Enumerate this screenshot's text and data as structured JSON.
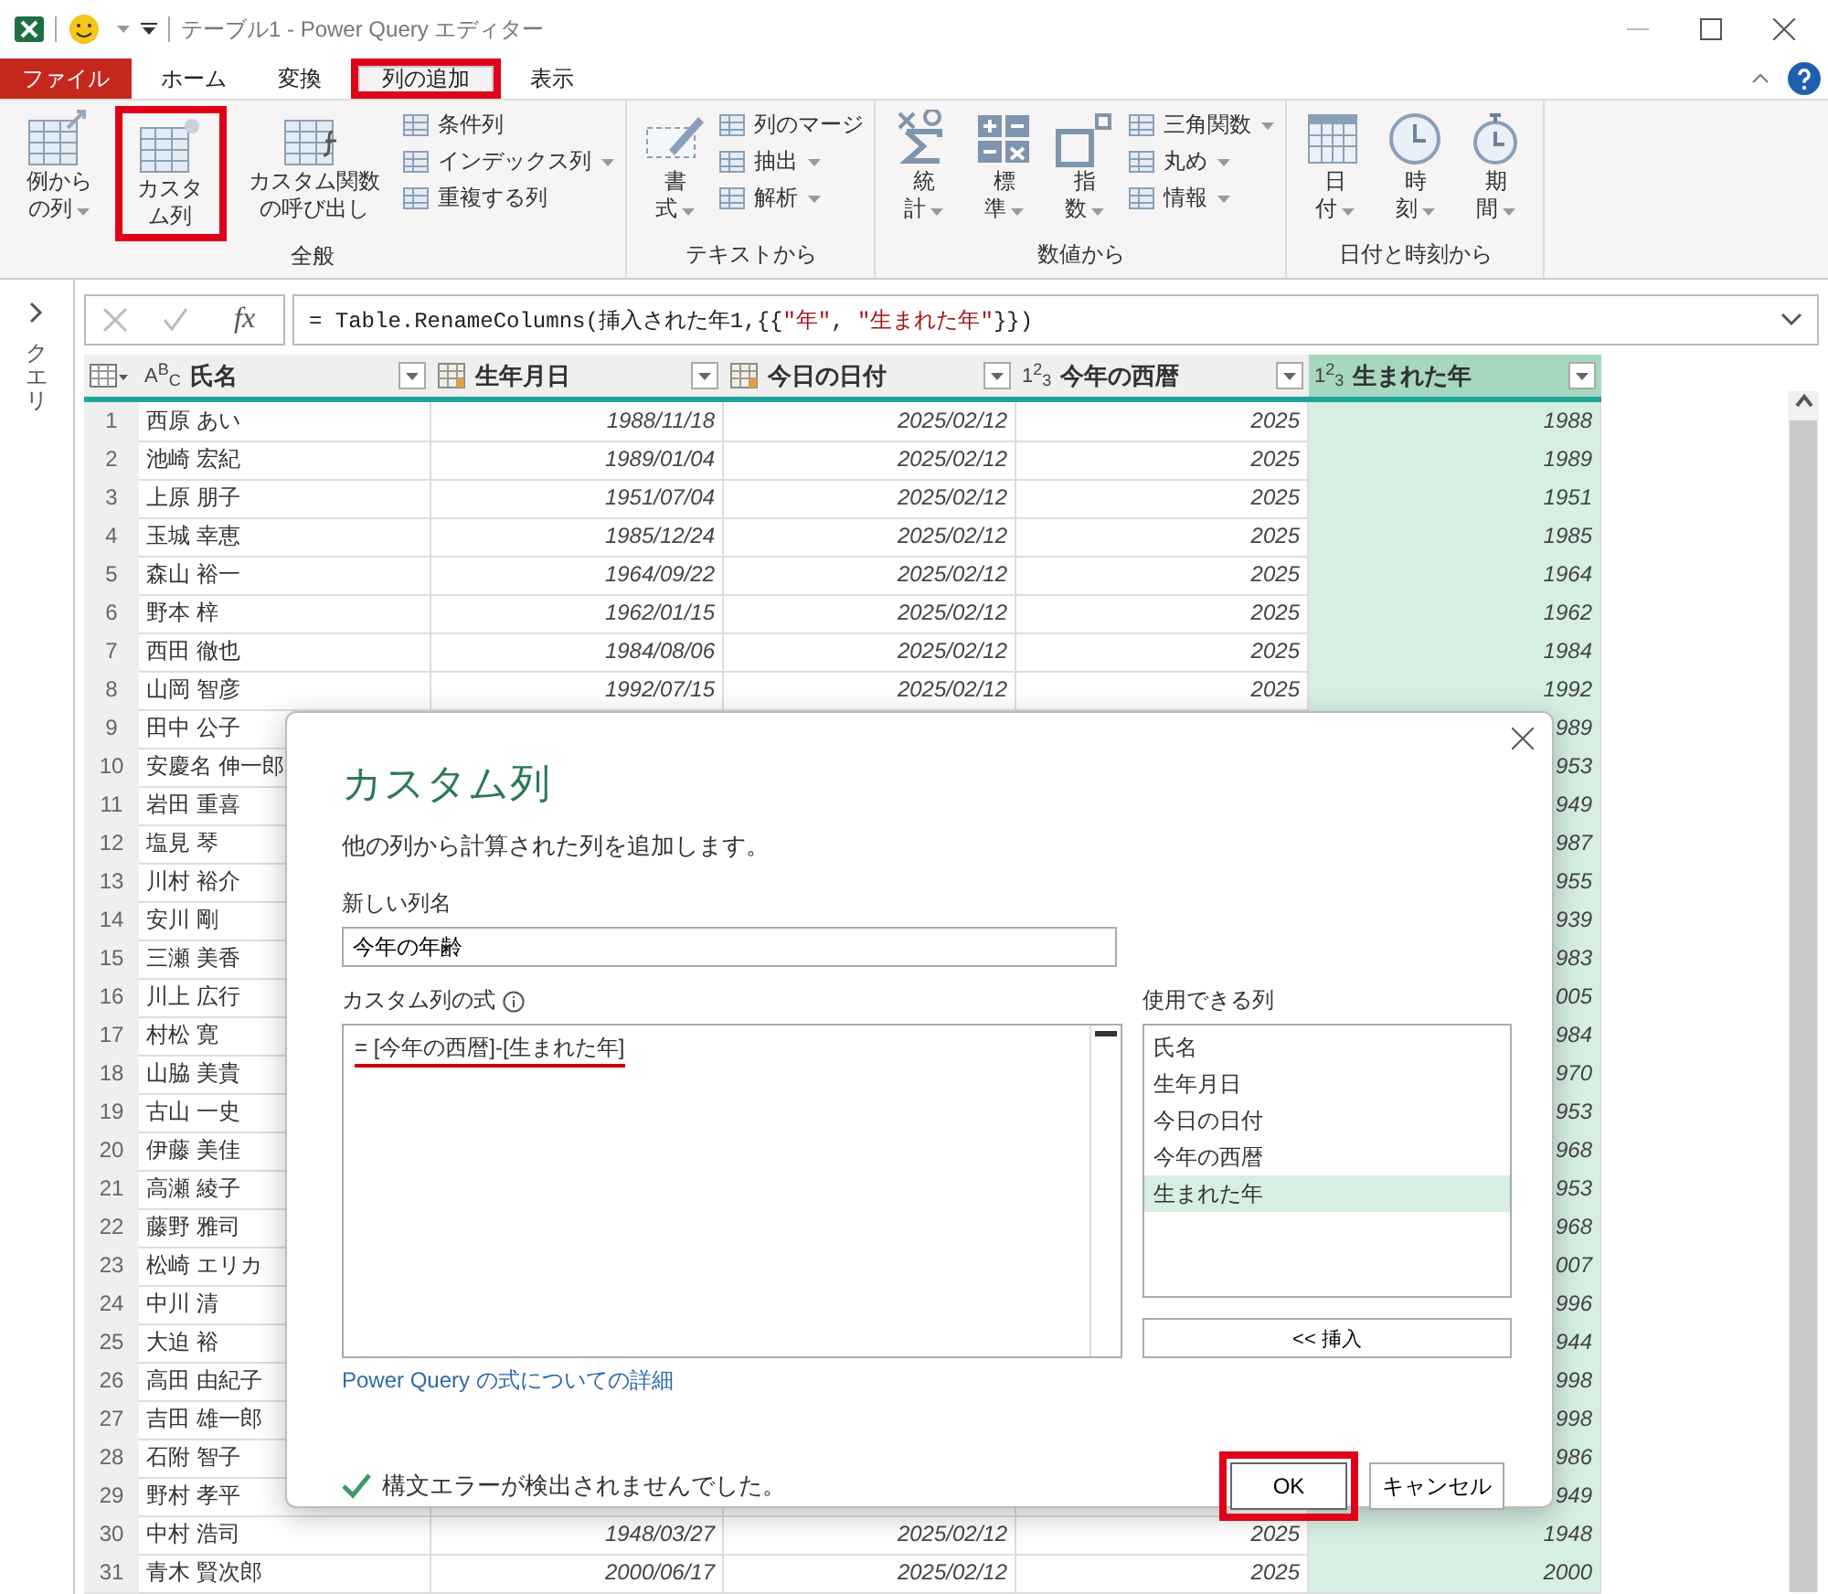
{
  "window": {
    "title": "テーブル1 - Power Query エディター"
  },
  "tabs": [
    {
      "label": "ファイル",
      "kind": "file",
      "selected": false,
      "highlighted": false
    },
    {
      "label": "ホーム",
      "kind": "tab",
      "selected": false,
      "highlighted": false
    },
    {
      "label": "変換",
      "kind": "tab",
      "selected": false,
      "highlighted": false
    },
    {
      "label": "列の追加",
      "kind": "tab",
      "selected": true,
      "highlighted": true
    },
    {
      "label": "表示",
      "kind": "tab",
      "selected": false,
      "highlighted": false
    }
  ],
  "ribbon": {
    "groups": [
      {
        "label": "全般",
        "large": [
          {
            "label": "例からの列",
            "dropdown": true,
            "highlighted": false
          },
          {
            "label": "カスタム列",
            "dropdown": false,
            "highlighted": true
          },
          {
            "label": "カスタム関数の呼び出し",
            "dropdown": false,
            "highlighted": false
          }
        ],
        "small": [
          {
            "label": "条件列",
            "dropdown": false
          },
          {
            "label": "インデックス列",
            "dropdown": true
          },
          {
            "label": "重複する列",
            "dropdown": false
          }
        ]
      },
      {
        "label": "テキストから",
        "large": [
          {
            "label": "書式",
            "dropdown": true,
            "highlighted": false
          }
        ],
        "small": [
          {
            "label": "列のマージ",
            "dropdown": false
          },
          {
            "label": "抽出",
            "dropdown": true
          },
          {
            "label": "解析",
            "dropdown": true
          }
        ]
      },
      {
        "label": "数値から",
        "large": [
          {
            "label": "統計",
            "dropdown": true,
            "highlighted": false
          },
          {
            "label": "標準",
            "dropdown": true,
            "highlighted": false
          },
          {
            "label": "指数",
            "dropdown": true,
            "highlighted": false
          }
        ],
        "small": [
          {
            "label": "三角関数",
            "dropdown": true
          },
          {
            "label": "丸め",
            "dropdown": true
          },
          {
            "label": "情報",
            "dropdown": true
          }
        ]
      },
      {
        "label": "日付と時刻から",
        "large": [
          {
            "label": "日付",
            "dropdown": true,
            "highlighted": false
          },
          {
            "label": "時刻",
            "dropdown": true,
            "highlighted": false
          },
          {
            "label": "期間",
            "dropdown": true,
            "highlighted": false
          }
        ]
      }
    ]
  },
  "queries_pane": {
    "label": "クエリ"
  },
  "formula_bar": {
    "function_label": "fx",
    "formula": [
      {
        "text": "= Table.RenameColumns(挿入された年1,{{",
        "kind": "code"
      },
      {
        "text": "\"年\"",
        "kind": "string"
      },
      {
        "text": ", ",
        "kind": "code"
      },
      {
        "text": "\"生まれた年\"",
        "kind": "string"
      },
      {
        "text": "}})",
        "kind": "code"
      }
    ]
  },
  "table": {
    "columns": [
      {
        "name": "氏名",
        "kind": "text",
        "type_label": "ABC",
        "selected": false
      },
      {
        "name": "生年月日",
        "kind": "date",
        "selected": false
      },
      {
        "name": "今日の日付",
        "kind": "date",
        "selected": false
      },
      {
        "name": "今年の西暦",
        "kind": "number",
        "type_label": "123",
        "selected": false
      },
      {
        "name": "生まれた年",
        "kind": "number",
        "type_label": "123",
        "selected": true
      }
    ],
    "rows": [
      {
        "number": "1",
        "name": "西原 あい",
        "birth_date": "1988/11/18",
        "today": "2025/02/12",
        "this_year": "2025",
        "birth_year": "1988"
      },
      {
        "number": "2",
        "name": "池崎 宏紀",
        "birth_date": "1989/01/04",
        "today": "2025/02/12",
        "this_year": "2025",
        "birth_year": "1989"
      },
      {
        "number": "3",
        "name": "上原 朋子",
        "birth_date": "1951/07/04",
        "today": "2025/02/12",
        "this_year": "2025",
        "birth_year": "1951"
      },
      {
        "number": "4",
        "name": "玉城 幸恵",
        "birth_date": "1985/12/24",
        "today": "2025/02/12",
        "this_year": "2025",
        "birth_year": "1985"
      },
      {
        "number": "5",
        "name": "森山 裕一",
        "birth_date": "1964/09/22",
        "today": "2025/02/12",
        "this_year": "2025",
        "birth_year": "1964"
      },
      {
        "number": "6",
        "name": "野本 梓",
        "birth_date": "1962/01/15",
        "today": "2025/02/12",
        "this_year": "2025",
        "birth_year": "1962"
      },
      {
        "number": "7",
        "name": "西田 徹也",
        "birth_date": "1984/08/06",
        "today": "2025/02/12",
        "this_year": "2025",
        "birth_year": "1984"
      },
      {
        "number": "8",
        "name": "山岡 智彦",
        "birth_date": "1992/07/15",
        "today": "2025/02/12",
        "this_year": "2025",
        "birth_year": "1992"
      },
      {
        "number": "9",
        "name": "田中 公子",
        "birth_year": "989"
      },
      {
        "number": "10",
        "name": "安慶名 伸一郎",
        "birth_year": "953"
      },
      {
        "number": "11",
        "name": "岩田 重喜",
        "birth_year": "949"
      },
      {
        "number": "12",
        "name": "塩見 琴",
        "birth_year": "987"
      },
      {
        "number": "13",
        "name": "川村 裕介",
        "birth_year": "955"
      },
      {
        "number": "14",
        "name": "安川 剛",
        "birth_year": "939"
      },
      {
        "number": "15",
        "name": "三瀬 美香",
        "birth_year": "983"
      },
      {
        "number": "16",
        "name": "川上 広行",
        "birth_year": "005"
      },
      {
        "number": "17",
        "name": "村松 寛",
        "birth_year": "984"
      },
      {
        "number": "18",
        "name": "山脇 美貴",
        "birth_year": "970"
      },
      {
        "number": "19",
        "name": "古山 一史",
        "birth_year": "953"
      },
      {
        "number": "20",
        "name": "伊藤 美佳",
        "birth_year": "968"
      },
      {
        "number": "21",
        "name": "高瀬 綾子",
        "birth_year": "953"
      },
      {
        "number": "22",
        "name": "藤野 雅司",
        "birth_year": "968"
      },
      {
        "number": "23",
        "name": "松崎 エリカ",
        "birth_year": "007"
      },
      {
        "number": "24",
        "name": "中川 清",
        "birth_year": "996"
      },
      {
        "number": "25",
        "name": "大迫 裕",
        "birth_year": "944"
      },
      {
        "number": "26",
        "name": "高田 由紀子",
        "birth_year": "998"
      },
      {
        "number": "27",
        "name": "吉田 雄一郎",
        "birth_year": "998"
      },
      {
        "number": "28",
        "name": "石附 智子",
        "birth_year": "986"
      },
      {
        "number": "29",
        "name": "野村 孝平",
        "birth_year": "949"
      },
      {
        "number": "30",
        "name": "中村 浩司",
        "birth_date": "1948/03/27",
        "today": "2025/02/12",
        "this_year": "2025",
        "birth_year": "1948"
      },
      {
        "number": "31",
        "name": "青木 賢次郎",
        "birth_date": "2000/06/17",
        "today": "2025/02/12",
        "this_year": "2025",
        "birth_year": "2000"
      }
    ]
  },
  "dialog": {
    "title": "カスタム列",
    "description": "他の列から計算された列を追加します。",
    "name_label": "新しい列名",
    "name_value": "今年の年齢",
    "formula_label": "カスタム列の式",
    "formula": "= [今年の西暦]-[生まれた年]",
    "formula_underlined": true,
    "columns_label": "使用できる列",
    "columns": [
      {
        "label": "氏名",
        "selected": false
      },
      {
        "label": "生年月日",
        "selected": false
      },
      {
        "label": "今日の日付",
        "selected": false
      },
      {
        "label": "今年の西暦",
        "selected": false
      },
      {
        "label": "生まれた年",
        "selected": true
      }
    ],
    "insert_button": "<< 挿入",
    "link": "Power Query の式についての詳細",
    "status": "構文エラーが検出されませんでした。",
    "ok": {
      "label": "OK",
      "highlighted": true
    },
    "cancel": "キャンセル"
  }
}
